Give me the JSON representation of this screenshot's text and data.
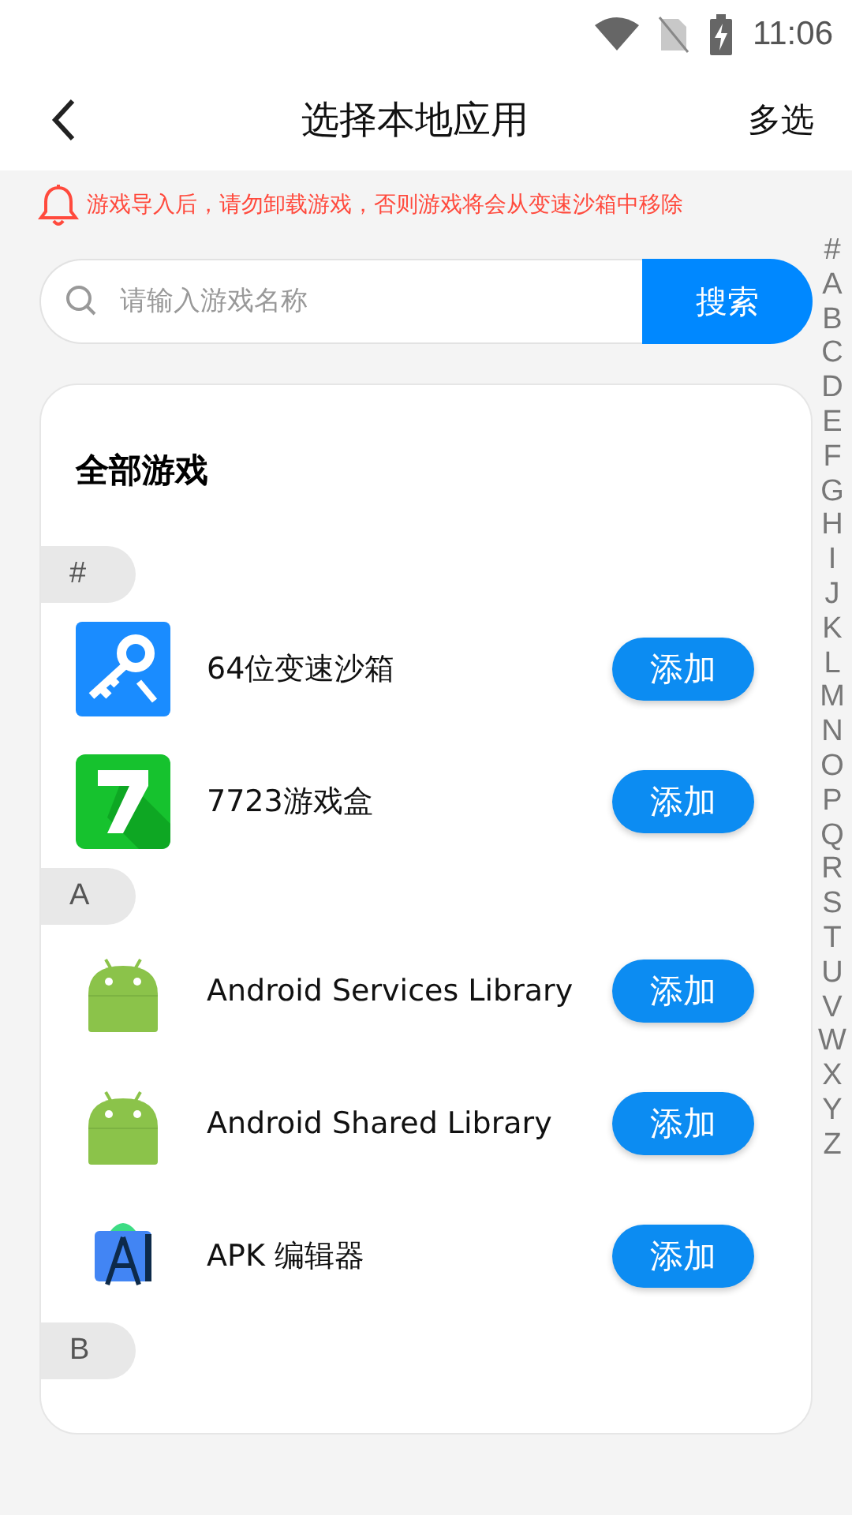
{
  "status_bar": {
    "time": "11:06"
  },
  "header": {
    "title": "选择本地应用",
    "action": "多选"
  },
  "notice": "游戏导入后，请勿卸载游戏，否则游戏将会从变速沙箱中移除",
  "search": {
    "placeholder": "请输入游戏名称",
    "button": "搜索"
  },
  "index_bar": [
    "#",
    "A",
    "B",
    "C",
    "D",
    "E",
    "F",
    "G",
    "H",
    "I",
    "J",
    "K",
    "L",
    "M",
    "N",
    "O",
    "P",
    "Q",
    "R",
    "S",
    "T",
    "U",
    "V",
    "W",
    "X",
    "Y",
    "Z"
  ],
  "list": {
    "title": "全部游戏",
    "sections": [
      {
        "letter": "#",
        "apps": [
          {
            "name": "64位变速沙箱",
            "kind": "key",
            "button": "添加"
          },
          {
            "name": "7723游戏盒",
            "kind": "seven",
            "button": "添加"
          }
        ]
      },
      {
        "letter": "A",
        "apps": [
          {
            "name": "Android Services Library",
            "kind": "android",
            "button": "添加"
          },
          {
            "name": "Android Shared Library",
            "kind": "android",
            "button": "添加"
          },
          {
            "name": "APK 编辑器",
            "kind": "apk",
            "button": "添加"
          }
        ]
      },
      {
        "letter": "B"
      }
    ]
  }
}
